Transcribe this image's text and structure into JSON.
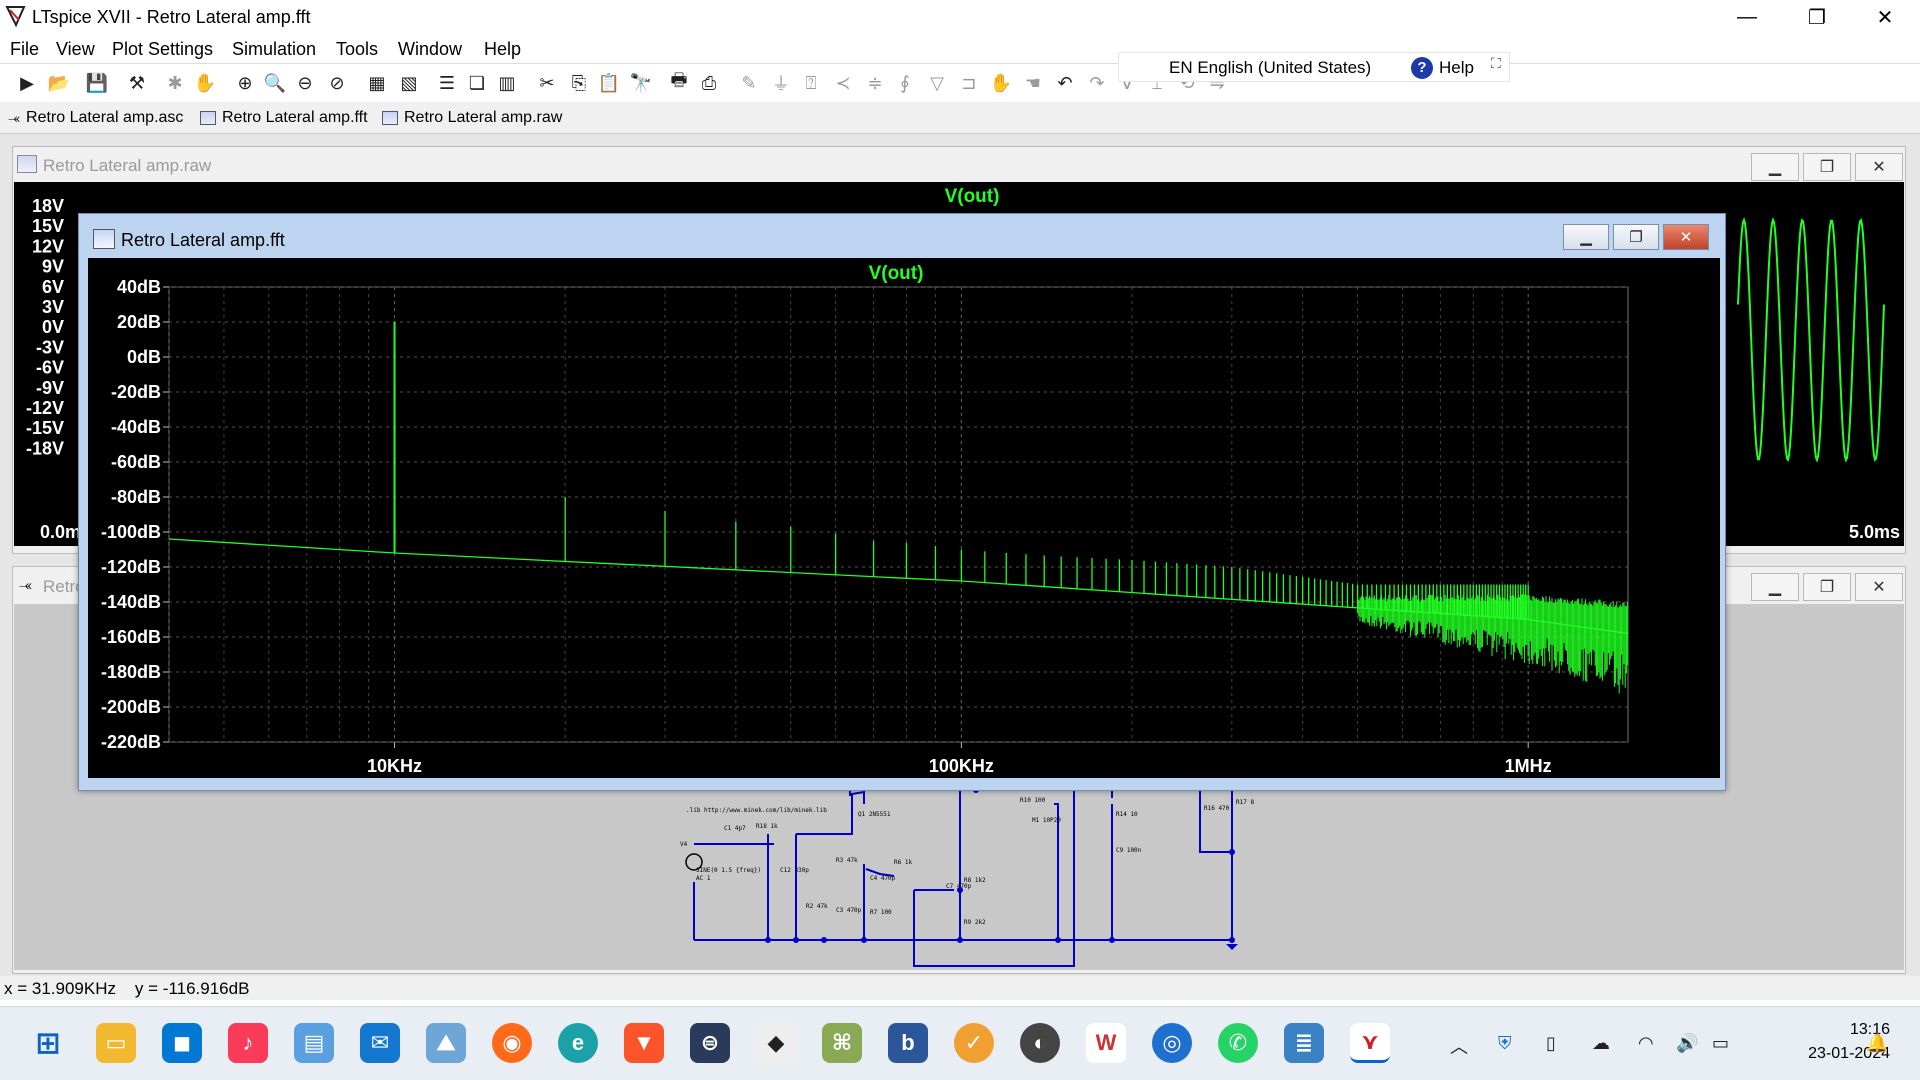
{
  "window": {
    "title": "LTspice XVII - Retro Lateral amp.fft",
    "minimize": "—",
    "maximize": "❐",
    "close": "✕"
  },
  "menu": [
    "File",
    "View",
    "Plot Settings",
    "Simulation",
    "Tools",
    "Window",
    "Help"
  ],
  "language": {
    "label": "EN English (United States)",
    "help": "Help",
    "help_icon": "?"
  },
  "tabs": [
    "Retro Lateral amp.asc",
    "Retro Lateral amp.fft",
    "Retro Lateral amp.raw"
  ],
  "raw_window": {
    "title": "Retro Lateral amp.raw",
    "trace": "V(out)",
    "yticks": [
      "18V",
      "15V",
      "12V",
      "9V",
      "6V",
      "3V",
      "0V",
      "-3V",
      "-6V",
      "-9V",
      "-12V",
      "-15V",
      "-18V"
    ],
    "x_start": "0.0ms",
    "x_end": "5.0ms"
  },
  "sch_window": {
    "title": "Retro Lateral amp.asc"
  },
  "fft_window": {
    "title": "Retro Lateral amp.fft"
  },
  "schematic": {
    "directive": ".lib http://www.minek.com/lib/minek.lib",
    "source_name": "V4",
    "source_value": "SINE(0 1.5 {freq})",
    "source_ac": "AC 1",
    "parts": [
      "C1 4p7",
      "R18 1k",
      "C12 330p",
      "R3 47k",
      "R2 47k",
      "C3 470p",
      "Q1 2N5551",
      "C4 470p",
      "R7 100",
      "R6 1k",
      "C7 470p",
      "R8 1k2",
      "R9 2k2",
      "R10 100",
      "M1 10P20",
      "R14 10",
      "C9 100n",
      "R16 470",
      "R17 8"
    ]
  },
  "status": {
    "x": "x = 31.909KHz",
    "y": "y = -116.916dB"
  },
  "clock": {
    "time": "13:16",
    "date": "23-01-2024"
  },
  "chart_data": {
    "type": "line",
    "title": "V(out)",
    "x_scale": "log",
    "xlim": [
      4000,
      1500000
    ],
    "ylim": [
      -220,
      40
    ],
    "yticks": [
      40,
      20,
      0,
      -20,
      -40,
      -60,
      -80,
      -100,
      -120,
      -140,
      -160,
      -180,
      -200,
      -220
    ],
    "ytick_labels": [
      "40dB",
      "20dB",
      "0dB",
      "-20dB",
      "-40dB",
      "-60dB",
      "-80dB",
      "-100dB",
      "-120dB",
      "-140dB",
      "-160dB",
      "-180dB",
      "-200dB",
      "-220dB"
    ],
    "xticks": [
      10000,
      100000,
      1000000
    ],
    "xtick_labels": [
      "10KHz",
      "100KHz",
      "1MHz"
    ],
    "grid": true,
    "color": "#22ff22",
    "noise_floor": {
      "x": [
        4000,
        10000,
        100000,
        1000000,
        1500000
      ],
      "y": [
        -104,
        -112,
        -128,
        -150,
        -158
      ]
    },
    "harmonics": {
      "x": [
        10000,
        20000,
        30000,
        40000,
        50000,
        60000,
        70000,
        80000,
        90000,
        100000,
        120000,
        150000,
        200000,
        300000,
        500000
      ],
      "y": [
        20,
        -80,
        -88,
        -94,
        -97,
        -101,
        -105,
        -106,
        -108,
        -110,
        -112,
        -114,
        -116,
        -120,
        -130
      ]
    }
  }
}
